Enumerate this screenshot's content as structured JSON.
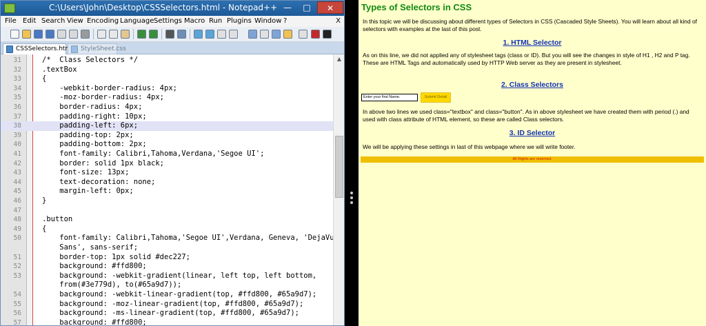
{
  "notepad": {
    "title": "C:\\Users\\John\\Desktop\\CSSSelectors.html - Notepad++",
    "window_buttons": {
      "minimize": "—",
      "maximize": "□",
      "close": "✕"
    },
    "menu": [
      "File",
      "Edit",
      "Search",
      "View",
      "Encoding",
      "Language",
      "Settings",
      "Macro",
      "Run",
      "Plugins",
      "Window",
      "?"
    ],
    "menu_close": "X",
    "tabs": [
      "CSSSelectors.html",
      "StyleSheet.css"
    ],
    "lines": [
      {
        "n": "31",
        "code": "/*  Class Selectors */"
      },
      {
        "n": "32",
        "code": ".textBox"
      },
      {
        "n": "33",
        "code": "{"
      },
      {
        "n": "34",
        "code": "    -webkit-border-radius: 4px;"
      },
      {
        "n": "35",
        "code": "    -moz-border-radius: 4px;"
      },
      {
        "n": "36",
        "code": "    border-radius: 4px;"
      },
      {
        "n": "37",
        "code": "    padding-right: 10px;"
      },
      {
        "n": "38",
        "code": "    padding-left: 6px;"
      },
      {
        "n": "39",
        "code": "    padding-top: 2px;"
      },
      {
        "n": "40",
        "code": "    padding-bottom: 2px;"
      },
      {
        "n": "41",
        "code": "    font-family: Calibri,Tahoma,Verdana,'Segoe UI';"
      },
      {
        "n": "42",
        "code": "    border: solid 1px black;"
      },
      {
        "n": "43",
        "code": "    font-size: 13px;"
      },
      {
        "n": "44",
        "code": "    text-decoration: none;"
      },
      {
        "n": "45",
        "code": "    margin-left: 0px;"
      },
      {
        "n": "46",
        "code": "}"
      },
      {
        "n": "47",
        "code": ""
      },
      {
        "n": "48",
        "code": ".button"
      },
      {
        "n": "49",
        "code": "{"
      },
      {
        "n": "50",
        "code": "    font-family: Calibri,Tahoma,'Segoe UI',Verdana, Geneva, 'DejaVu"
      },
      {
        "n": "",
        "code": "    Sans', sans-serif;"
      },
      {
        "n": "51",
        "code": "    border-top: 1px solid #dec227;"
      },
      {
        "n": "52",
        "code": "    background: #ffd800;"
      },
      {
        "n": "53",
        "code": "    background: -webkit-gradient(linear, left top, left bottom,"
      },
      {
        "n": "",
        "code": "    from(#3e779d), to(#65a9d7));"
      },
      {
        "n": "54",
        "code": "    background: -webkit-linear-gradient(top, #ffd800, #65a9d7);"
      },
      {
        "n": "55",
        "code": "    background: -moz-linear-gradient(top, #ffd800, #65a9d7);"
      },
      {
        "n": "56",
        "code": "    background: -ms-linear-gradient(top, #ffd800, #65a9d7);"
      },
      {
        "n": "57",
        "code": "    background: #ffd800;"
      }
    ],
    "highlighted_line": "38"
  },
  "page": {
    "title": "Types of Selectors in CSS",
    "intro": "In this topic we will be discussing about different types of Selectors in CSS (Cascaded Style Sheets). You will learn about all kind of selectors with examples at the last of this post.",
    "h1": "1. HTML Selector",
    "p1": "As on this line, we did not applied any of stylesheet tags (class or ID). But you will see the changes in style of H1 , H2 and P tag. These are HTML Tags and automatically used by HTTP Web server as they are present in stylesheet.",
    "h2": "2. Class Selectors",
    "textbox_value": "Enter your first Name.",
    "button_label": "Submit Detail",
    "p2": "In above two lines we used class=\"textbox\" and class=\"button\". As in above stylesheet we have created them with period (.) and used with class attribute of HTML element, so these are called Class selectors.",
    "h3": "3. ID Selector",
    "p3": "We will be applying these settings in last of this webpage where we will write footer.",
    "footer": "All Rights are reserved."
  },
  "colors": {
    "page_bg": "#ffffcc",
    "title_green": "#138a13",
    "heading_blue": "#1232b5",
    "button_yellow": "#ffd800",
    "footer_bg": "#f0c000",
    "footer_text": "#d51313",
    "line_highlight": "#e2e2f6"
  }
}
